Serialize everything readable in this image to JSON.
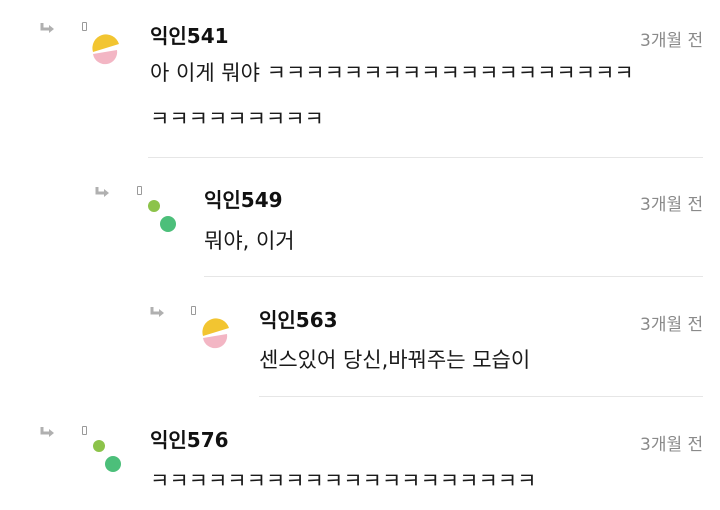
{
  "comments": [
    {
      "author": "익인541",
      "time": "3개월 전",
      "lines": [
        "아 이게 뭐야 ㅋㅋㅋㅋㅋㅋㅋㅋㅋㅋㅋㅋㅋㅋㅋㅋㅋㅋㅋ",
        "ㅋㅋㅋㅋㅋㅋㅋㅋㅋ"
      ],
      "avatar": "yellow-pink"
    },
    {
      "author": "익인549",
      "time": "3개월 전",
      "lines": [
        "뭐야, 이거"
      ],
      "avatar": "green-dots"
    },
    {
      "author": "익인563",
      "time": "3개월 전",
      "lines": [
        "센스있어 당신,바꿔주는 모습이"
      ],
      "avatar": "yellow-pink"
    },
    {
      "author": "익인576",
      "time": "3개월 전",
      "lines": [
        "ㅋㅋㅋㅋㅋㅋㅋㅋㅋㅋㅋㅋㅋㅋㅋㅋㅋㅋㅋㅋ"
      ],
      "avatar": "green-dots"
    }
  ],
  "colors": {
    "avatar_yellow": "#f2c531",
    "avatar_pink": "#f3b6c4",
    "avatar_green_light": "#8cc34a",
    "avatar_green": "#4cbf7a",
    "reply_icon": "#b0b0b0"
  }
}
